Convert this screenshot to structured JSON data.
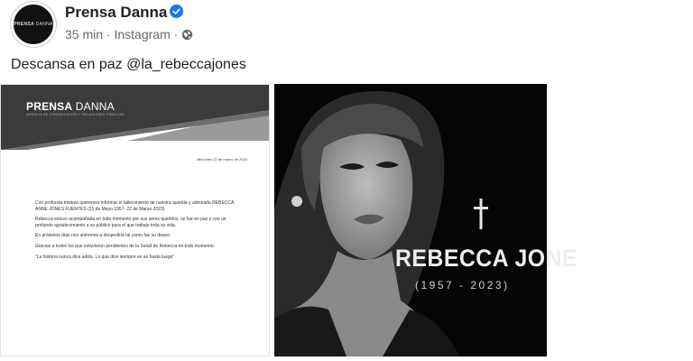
{
  "post": {
    "author": "Prensa Danna",
    "time": "35 min",
    "separator1": "·",
    "source": "Instagram",
    "separator2": "·",
    "text": "Descansa en paz @la_rebeccajones",
    "avatar_brand": "PRENSA",
    "avatar_brand_light": "DANNA"
  },
  "icons": {
    "verified": "verified-badge-icon",
    "globe": "globe-icon",
    "cross": "cross-icon"
  },
  "colors": {
    "verified": "#1877f2",
    "meta": "#65676b",
    "banner_dark": "#3b3b3b",
    "banner_light": "#9a9a9a"
  },
  "document": {
    "brand_bold": "PRENSA",
    "brand_light": "DANNA",
    "brand_sub": "AGENCIA DE COMUNICACIÓN Y RELACIONES PÚBLICAS",
    "date": "Miércoles 22 de marzo de 2023",
    "paragraphs": [
      "Con profunda tristeza queremos informar el fallecimiento de nuestra querida y admirada REBECCA ANNE JONES FUENTES (21 de Mayo 1957- 22 de Marzo 2023)",
      "Rebecca estuvo acompañada en todo momento por sus seres queridos, se fue en paz y con un profundo agradecimiento a su público para el que trabajo toda su vida.",
      "En próximos días nos uniremos a despedirla tal como fue su deseo.",
      "Gracias a todos los que estuvieron pendientes de la Salud de Rebecca en todo momento.",
      "\"La historia nunca dice adiós. Lo que dice siempre es un hasta luego\""
    ]
  },
  "photo": {
    "name": "REBECCA JONE",
    "years": "(1957 - 2023)"
  }
}
